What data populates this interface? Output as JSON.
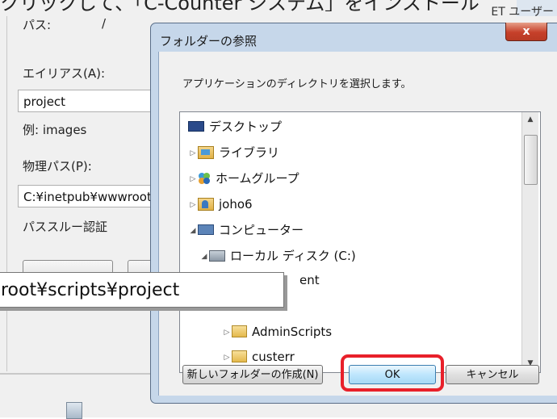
{
  "banner": {
    "text": "クリックして、「C-Counter システム」をインストール"
  },
  "background_dialog": {
    "right_title": "ET ユーザー",
    "path_label": "パス:",
    "path_value": "/",
    "alias_label": "エイリアス(A):",
    "alias_value": "project",
    "example_label": "例: images",
    "physical_path_label": "物理パス(P):",
    "physical_path_value": "C:¥inetpub¥wwwroot",
    "pass_through_label": "パススルー認証"
  },
  "tooltip": {
    "path": "root¥scripts¥project"
  },
  "folder_dialog": {
    "title": "フォルダーの参照",
    "close_label": "x",
    "description": "アプリケーションのディレクトリを選択します。",
    "tree": [
      {
        "label": "デスクトップ",
        "icon": "desktop-icon",
        "expander": ""
      },
      {
        "label": "ライブラリ",
        "icon": "library-icon",
        "expander": "▷"
      },
      {
        "label": "ホームグループ",
        "icon": "homegroup-icon",
        "expander": "▷"
      },
      {
        "label": "joho6",
        "icon": "user-folder-icon",
        "expander": "▷"
      },
      {
        "label": "コンピューター",
        "icon": "computer-icon",
        "expander": "◢"
      },
      {
        "label": "ローカル ディスク (C:)",
        "icon": "disk-icon",
        "expander": "◢"
      },
      {
        "label": "ent",
        "icon": "folder-icon",
        "expander": ""
      },
      {
        "label": "",
        "icon": "",
        "expander": ""
      },
      {
        "label": "AdminScripts",
        "icon": "folder-icon",
        "expander": "▷"
      },
      {
        "label": "custerr",
        "icon": "folder-icon",
        "expander": "▷"
      }
    ],
    "buttons": {
      "new_folder": "新しいフォルダーの作成(N)",
      "ok": "OK",
      "cancel": "キャンセル"
    }
  },
  "colors": {
    "highlight": "#e8202a",
    "title_bar": "#c6d7ea",
    "close_button": "#c6402a"
  }
}
